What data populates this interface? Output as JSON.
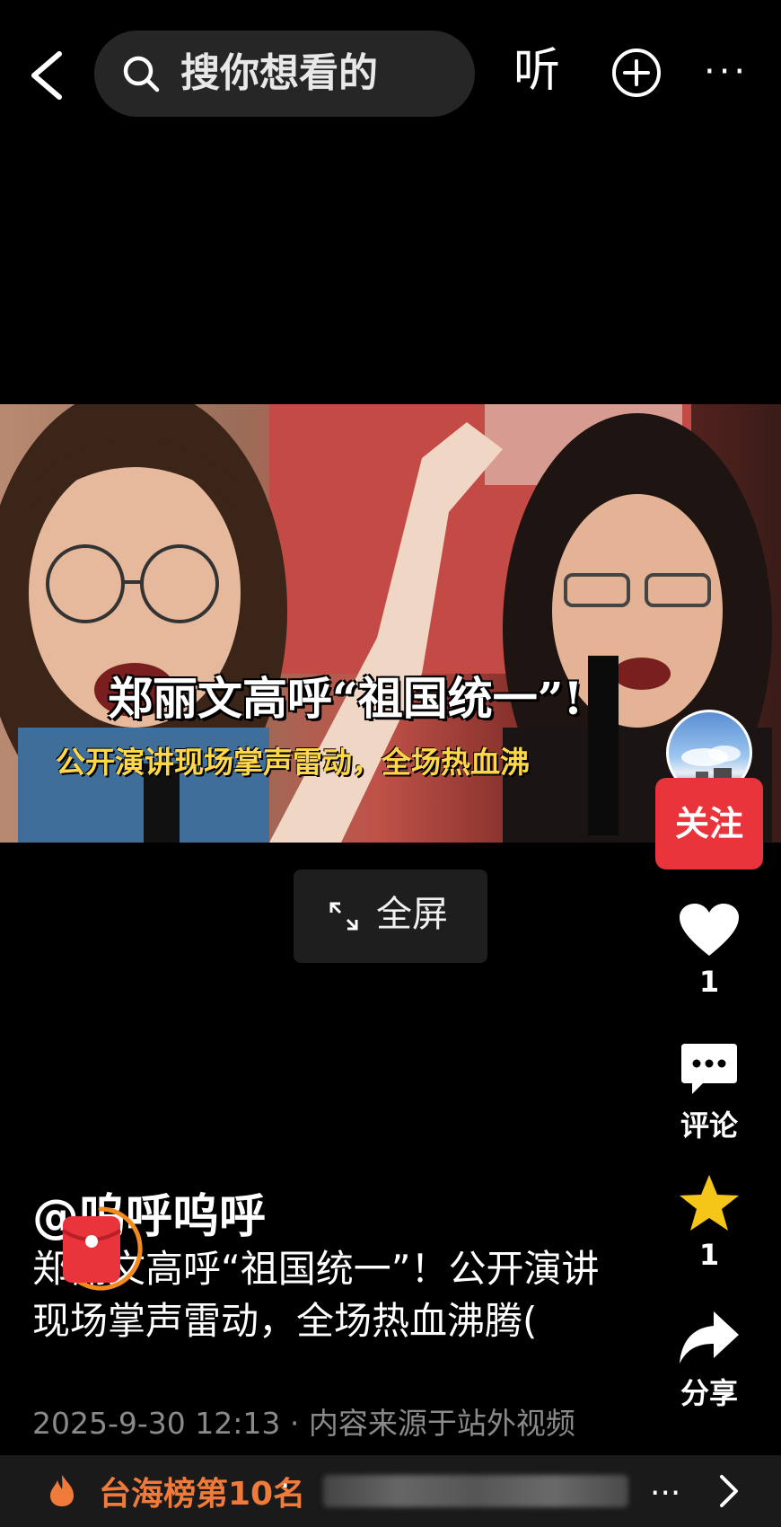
{
  "header": {
    "search_placeholder": "搜你想看的",
    "listen_label": "听",
    "more_label": "···"
  },
  "video": {
    "overlay_title": "郑丽文高呼“祖国统一”!",
    "overlay_subtitle": "公开演讲现场掌声雷动，全场热血沸",
    "fullscreen_label": "全屏"
  },
  "rail": {
    "follow_label": "关注",
    "like_count": "1",
    "comment_label": "评论",
    "favorite_count": "1",
    "share_label": "分享"
  },
  "post": {
    "author": "@呜呼呜呼",
    "description": "郑丽文高呼“祖国统一”！公开演讲现场掌声雷动，全场热血沸腾(",
    "timestamp": "2025-9-30 12:13",
    "separator": "·",
    "source": "内容来源于站外视频"
  },
  "banner": {
    "rank_text": "台海榜第10名",
    "separator": "·",
    "ellipsis": "..."
  },
  "colors": {
    "follow": "#e8343a",
    "favorite": "#f5c518",
    "rank": "#f07a3a"
  }
}
